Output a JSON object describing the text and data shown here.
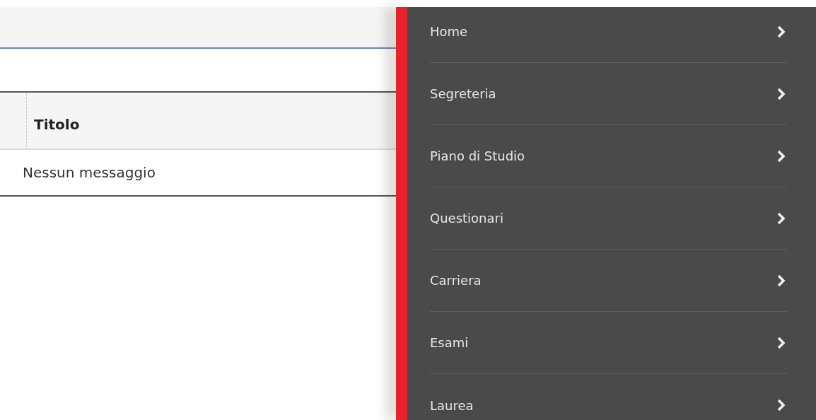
{
  "table": {
    "columns": [
      "Titolo"
    ],
    "empty_message": "Nessun messaggio"
  },
  "menu": {
    "items": [
      {
        "label": "Home"
      },
      {
        "label": "Segreteria"
      },
      {
        "label": "Piano di Studio"
      },
      {
        "label": "Questionari"
      },
      {
        "label": "Carriera"
      },
      {
        "label": "Esami"
      },
      {
        "label": "Laurea"
      }
    ]
  }
}
